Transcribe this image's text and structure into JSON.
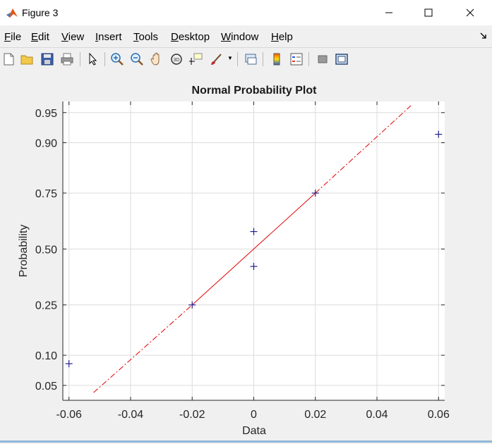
{
  "window": {
    "title": "Figure 3",
    "controls": {
      "minimize": "—",
      "maximize": "☐",
      "close": "✕"
    }
  },
  "menu": [
    {
      "accel": "F",
      "rest": "ile"
    },
    {
      "accel": "E",
      "rest": "dit"
    },
    {
      "accel": "V",
      "rest": "iew"
    },
    {
      "accel": "I",
      "rest": "nsert"
    },
    {
      "accel": "T",
      "rest": "ools"
    },
    {
      "accel": "D",
      "rest": "esktop"
    },
    {
      "accel": "W",
      "rest": "indow"
    },
    {
      "accel": "H",
      "rest": "elp"
    }
  ],
  "toolbar_icons": [
    "new-figure-icon",
    "open-file-icon",
    "save-icon",
    "print-icon",
    "edit-plot-arrow-icon",
    "zoom-in-icon",
    "zoom-out-icon",
    "pan-hand-icon",
    "rotate-3d-icon",
    "data-cursor-icon",
    "brush-icon",
    "link-plot-icon",
    "colorbar-icon",
    "legend-icon",
    "hide-plot-tools-icon",
    "show-plot-tools-icon"
  ],
  "colors": {
    "data_marker": "#1f1f8f",
    "reference_line": "#e00000",
    "axes_background": "#ffffff",
    "grid": "#dcdcdc"
  },
  "chart_data": {
    "type": "scatter",
    "title": "Normal Probability Plot",
    "xlabel": "Data",
    "ylabel": "Probability",
    "xlim": [
      -0.062,
      0.062
    ],
    "x_ticks": [
      -0.06,
      -0.04,
      -0.02,
      0,
      0.02,
      0.04,
      0.06
    ],
    "x_tick_labels": [
      "-0.06",
      "-0.04",
      "-0.02",
      "0",
      "0.02",
      "0.04",
      "0.06"
    ],
    "y_scale": "normal-probability",
    "ylim_probability": [
      0.0417,
      0.958
    ],
    "y_ticks": [
      0.05,
      0.1,
      0.25,
      0.5,
      0.75,
      0.9,
      0.95
    ],
    "y_tick_labels": [
      "0.05",
      "0.10",
      "0.25",
      "0.50",
      "0.75",
      "0.90",
      "0.95"
    ],
    "grid": true,
    "points": [
      {
        "x": -0.06,
        "p": 0.0833
      },
      {
        "x": -0.02,
        "p": 0.25
      },
      {
        "x": 0,
        "p": 0.4167
      },
      {
        "x": 0,
        "p": 0.5833
      },
      {
        "x": 0.02,
        "p": 0.75
      },
      {
        "x": 0.06,
        "p": 0.9167
      }
    ],
    "marker": "+",
    "reference_line": {
      "style": "solid between quartiles, dash-dot extrapolation",
      "solid_from": {
        "x": -0.02,
        "p": 0.25
      },
      "solid_to": {
        "x": 0.02,
        "p": 0.75
      },
      "extended_from": {
        "x": -0.052,
        "p": 0.0417
      },
      "extended_to": {
        "x": 0.051,
        "p": 0.958
      }
    }
  }
}
